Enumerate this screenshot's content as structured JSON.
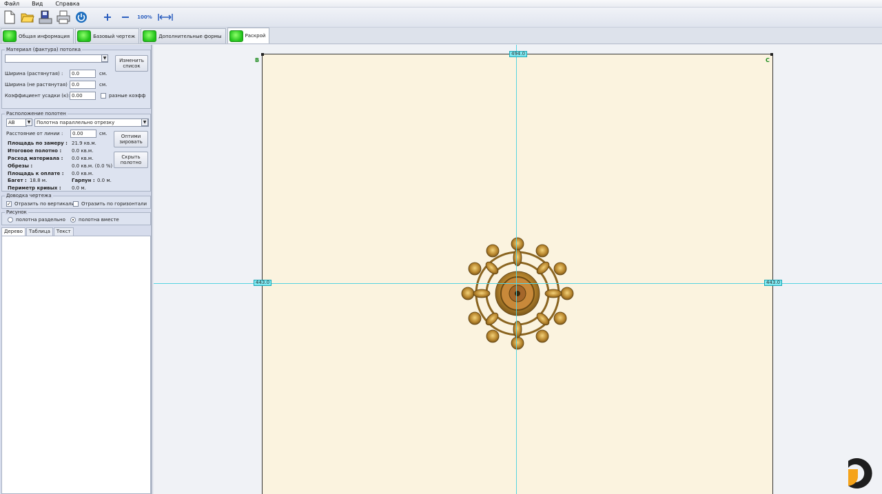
{
  "menu": {
    "file": "Файл",
    "view": "Вид",
    "help": "Справка"
  },
  "toolbar": {
    "icons": [
      "new-document-icon",
      "open-folder-icon",
      "save-icon",
      "print-icon",
      "power-icon",
      "zoom-in-icon",
      "zoom-out-icon",
      "zoom-100-icon",
      "fit-width-icon"
    ],
    "zoom100_label": "100%"
  },
  "tabs": [
    {
      "label": "Общая информация",
      "active": false
    },
    {
      "label": "Базовый чертеж",
      "active": false
    },
    {
      "label": "Дополнительные формы",
      "active": false
    },
    {
      "label": "Раскрой",
      "active": true
    }
  ],
  "material": {
    "title": "Материал (фактура) потолка",
    "select_value": "",
    "change_button": "Изменить список",
    "width_stretched_label": "Ширина (растянутая) :",
    "width_stretched_value": "0.0",
    "width_unstretched_label": "Ширина (не растянутая) :",
    "width_unstretched_value": "0.0",
    "unit_cm": "см.",
    "shrink_label": "Коэффициент усадки (к):",
    "shrink_value": "0.00",
    "diff_coeff_label": "разные коэфф"
  },
  "layout": {
    "title": "Расположение полотен",
    "segment_value": "AB",
    "orientation_value": "Полотна параллельно отрезку",
    "distance_label": "Расстояние от линии :",
    "distance_value": "0.00",
    "distance_unit": "см.",
    "optimize_button": "Оптими зировать",
    "hide_button": "Скрыть полотно",
    "stats": [
      {
        "label": "Площадь по замеру :",
        "value": "21.9 кв.м."
      },
      {
        "label": "Итоговое полотно :",
        "value": "0.0 кв.м."
      },
      {
        "label": "Расход материала :",
        "value": "0.0 кв.м."
      },
      {
        "label": "Обрезы :",
        "value": "0.0 кв.м. (0.0 %)"
      },
      {
        "label": "Площадь к оплате :",
        "value": "0.0 кв.м."
      }
    ],
    "baguette_label": "Багет :",
    "baguette_value": "18.8 м.",
    "harpoon_label": "Гарпун :",
    "harpoon_value": "0.0 м.",
    "curve_perimeter_label": "Периметр кривых :",
    "curve_perimeter_value": "0.0 м."
  },
  "finishing": {
    "title": "Доводка чертежа",
    "mirror_vertical_label": "Отразить по вертикали",
    "mirror_vertical_checked": true,
    "mirror_horizontal_label": "Отразить по горизонтали",
    "mirror_horizontal_checked": false
  },
  "drawing": {
    "title": "Рисунок",
    "separate_label": "полотна раздельно",
    "together_label": "полотна вместе",
    "selected": "together"
  },
  "subtabs": [
    "Дерево",
    "Таблица",
    "Текст"
  ],
  "canvas": {
    "top_dimension": "494.0",
    "left_dimension": "443.0",
    "right_dimension": "443.0",
    "corner_b": "B",
    "corner_c": "C",
    "sheet_color": "#fbf3df",
    "guide_color": "#55d3e0",
    "ornament_icon": "ceiling-rosette-icon"
  },
  "colors": {
    "tab_led": "#21c21a",
    "dimension_fill": "#7fe9f2",
    "logo_orange": "#f5a31a",
    "logo_dark": "#1e1e1e"
  }
}
